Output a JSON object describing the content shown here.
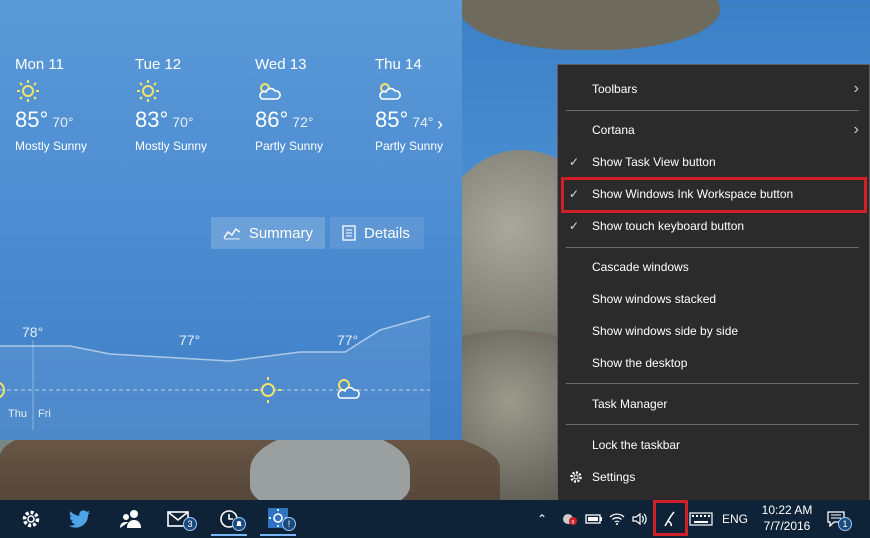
{
  "weather": {
    "days": [
      {
        "name": "Mon 11",
        "high": "85°",
        "low": "70°",
        "condition": "Mostly Sunny",
        "icon": "sunny-icon"
      },
      {
        "name": "Tue 12",
        "high": "83°",
        "low": "70°",
        "condition": "Mostly Sunny",
        "icon": "sunny-icon"
      },
      {
        "name": "Wed 13",
        "high": "86°",
        "low": "72°",
        "condition": "Partly Sunny",
        "icon": "partly-sunny-icon"
      },
      {
        "name": "Thu 14",
        "high": "85°",
        "low": "74°",
        "condition": "Partly Sunny",
        "icon": "partly-sunny-icon"
      }
    ],
    "tabs": {
      "summary": "Summary",
      "details": "Details"
    },
    "graph": {
      "temps": [
        "78°",
        "77°",
        "77°"
      ],
      "days": [
        "Thu",
        "Fri"
      ]
    }
  },
  "context_menu": {
    "items": [
      {
        "label": "Toolbars",
        "submenu": true,
        "checked": false
      },
      {
        "label": "Cortana",
        "submenu": true,
        "checked": false
      },
      {
        "label": "Show Task View button",
        "submenu": false,
        "checked": true
      },
      {
        "label": "Show Windows Ink Workspace button",
        "submenu": false,
        "checked": true
      },
      {
        "label": "Show touch keyboard button",
        "submenu": false,
        "checked": true
      },
      {
        "label": "Cascade windows",
        "submenu": false,
        "checked": false
      },
      {
        "label": "Show windows stacked",
        "submenu": false,
        "checked": false
      },
      {
        "label": "Show windows side by side",
        "submenu": false,
        "checked": false
      },
      {
        "label": "Show the desktop",
        "submenu": false,
        "checked": false
      },
      {
        "label": "Task Manager",
        "submenu": false,
        "checked": false
      },
      {
        "label": "Lock the taskbar",
        "submenu": false,
        "checked": false
      },
      {
        "label": "Settings",
        "submenu": false,
        "checked": false
      }
    ]
  },
  "taskbar": {
    "badges": {
      "people": "3",
      "alarms": "",
      "weather": "!"
    },
    "language": "ENG",
    "time": "10:22 AM",
    "date": "7/7/2016",
    "notifications": "1",
    "colors": {
      "highlight": "#d0202a",
      "taskbar": "#0f2338",
      "menu": "#2b2b2b"
    }
  }
}
